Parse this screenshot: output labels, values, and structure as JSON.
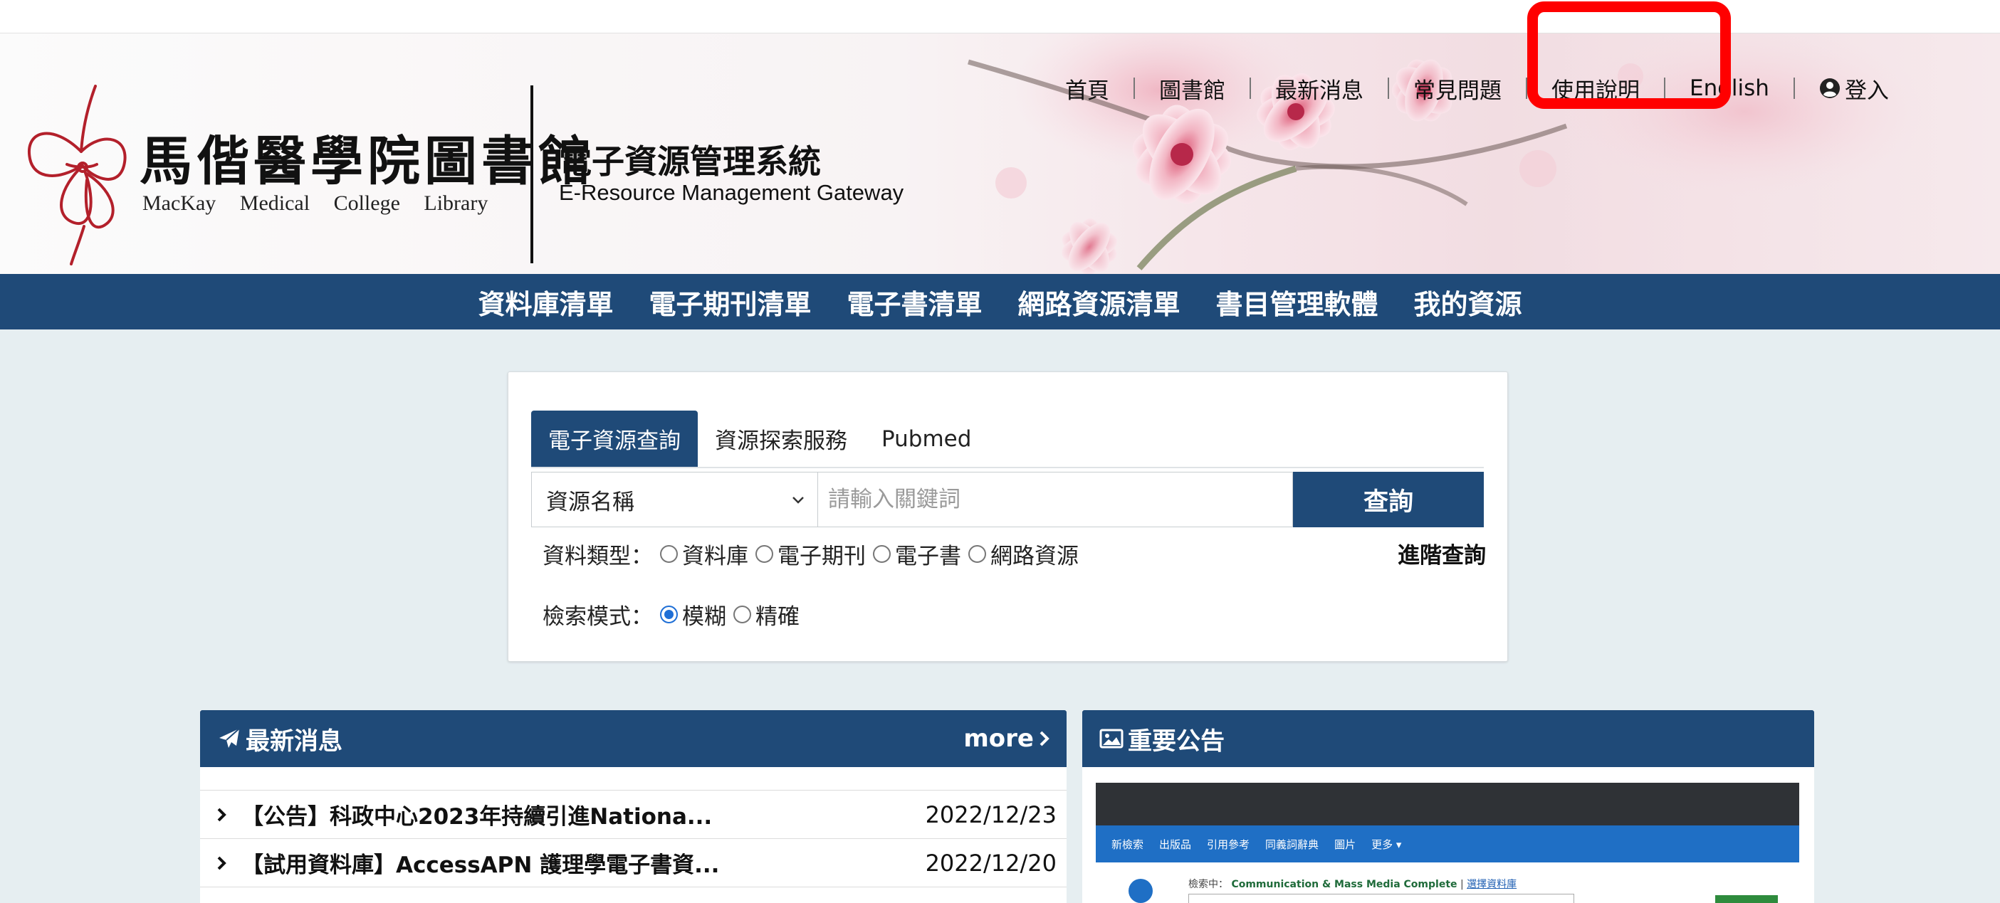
{
  "utility_nav": {
    "home": "首頁",
    "library": "圖書館",
    "news": "最新消息",
    "faq": "常見問題",
    "guide": "使用說明",
    "english": "English",
    "login": "登入"
  },
  "header": {
    "logo_cn": "馬偕醫學院圖書館",
    "logo_en": "MacKay Medical College Library",
    "system_title_cn": "電子資源管理系統",
    "system_title_en": "E-Resource Management Gateway"
  },
  "main_nav": [
    "資料庫清單",
    "電子期刊清單",
    "電子書清單",
    "網路資源清單",
    "書目管理軟體",
    "我的資源"
  ],
  "search": {
    "tabs": [
      "電子資源查詢",
      "資源探索服務",
      "Pubmed"
    ],
    "field_select": "資源名稱",
    "placeholder": "請輸入關鍵詞",
    "button": "查詢",
    "type_label": "資料類型：",
    "type_options": [
      "資料庫",
      "電子期刊",
      "電子書",
      "網路資源"
    ],
    "mode_label": "檢索模式：",
    "mode_options": [
      "模糊",
      "精確"
    ],
    "mode_selected": "模糊",
    "advanced": "進階查詢"
  },
  "news_panel": {
    "title": "最新消息",
    "more": "more",
    "items": [
      {
        "title": "【公告】科政中心2023年持續引進Nationa...",
        "date": "2022/12/23"
      },
      {
        "title": "【試用資料庫】AccessAPN 護理學電子書資...",
        "date": "2022/12/20"
      }
    ]
  },
  "notice_panel": {
    "title": "重要公告",
    "preview": {
      "menu": [
        "新檢索",
        "出版品",
        "引用參考",
        "同義詞辭典",
        "圖片",
        "更多 ▾"
      ],
      "search_prefix": "檢索中：",
      "database": "Communication & Mass Media Complete",
      "choose_db": "選擇資料庫"
    }
  },
  "colors": {
    "primary": "#1f4a78",
    "highlight": "#ff0000",
    "background": "#e6eef1"
  }
}
